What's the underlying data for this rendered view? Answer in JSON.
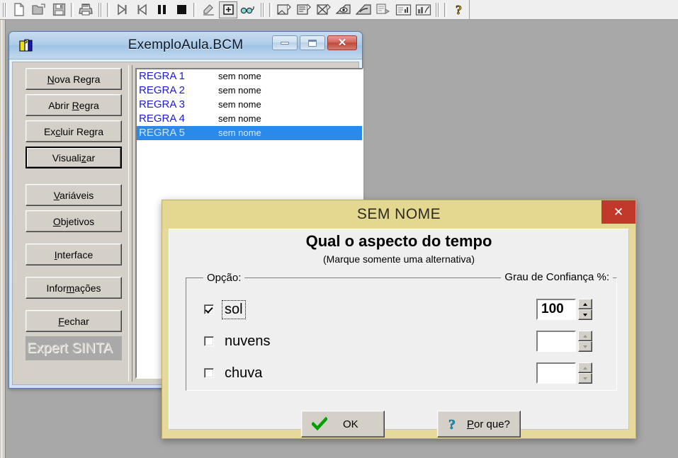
{
  "toolbar": {
    "groups": [
      {
        "name": "file-group",
        "icons": [
          "new-document-icon",
          "open-folder-icon",
          "save-disk-icon"
        ]
      },
      {
        "name": "print-group",
        "icons": [
          "print-icon"
        ]
      },
      {
        "name": "run-group",
        "icons": [
          "step-forward-icon",
          "step-back-icon",
          "pause-icon",
          "stop-icon"
        ]
      },
      {
        "name": "tools-group",
        "icons": [
          "wand-icon",
          "expand-box-icon",
          "glasses-icon"
        ]
      },
      {
        "name": "knowledge-group",
        "icons": [
          "rule-new-icon",
          "rule-edit-icon",
          "rule-delete-icon",
          "eye-view-icon",
          "inference-icon",
          "note-run-icon",
          "report-icon",
          "chart-icon"
        ]
      },
      {
        "name": "help-group",
        "icons": [
          "help-question-icon"
        ]
      }
    ]
  },
  "child_window": {
    "title": "ExemploAula.BCM",
    "icon": "expert-sinta-icon",
    "controls": {
      "minimize": "minimize-button",
      "maximize": "maximize-button",
      "close_glyph": "✕"
    },
    "buttons": [
      {
        "name": "nova-regra",
        "pre": "",
        "accel": "N",
        "post": "ova Regra",
        "default": false
      },
      {
        "name": "abrir-regra",
        "pre": "Abrir ",
        "accel": "R",
        "post": "egra",
        "default": false
      },
      {
        "name": "excluir-regra",
        "pre": "Ex",
        "accel": "c",
        "post": "luir Regra",
        "default": false
      },
      {
        "name": "visualizar",
        "pre": "Visuali",
        "accel": "z",
        "post": "ar",
        "default": true
      },
      {
        "name": "variaveis",
        "pre": "",
        "accel": "V",
        "post": "ariáveis",
        "default": false
      },
      {
        "name": "objetivos",
        "pre": "",
        "accel": "O",
        "post": "bjetivos",
        "default": false
      },
      {
        "name": "interface",
        "pre": "",
        "accel": "I",
        "post": "nterface",
        "default": false
      },
      {
        "name": "informacoes",
        "pre": "Infor",
        "accel": "m",
        "post": "ações",
        "default": false
      },
      {
        "name": "fechar",
        "pre": "",
        "accel": "F",
        "post": "echar",
        "default": false
      }
    ],
    "watermark": "Expert SINTA",
    "rules": [
      {
        "name": "REGRA  1",
        "desc": "sem nome",
        "selected": false
      },
      {
        "name": "REGRA  2",
        "desc": "sem nome",
        "selected": false
      },
      {
        "name": "REGRA  3",
        "desc": "sem nome",
        "selected": false
      },
      {
        "name": "REGRA  4",
        "desc": "sem nome",
        "selected": false
      },
      {
        "name": "REGRA  5",
        "desc": "sem nome",
        "selected": true
      }
    ]
  },
  "dialog": {
    "title": "SEM NOME",
    "close_glyph": "✕",
    "heading": "Qual o aspecto do tempo",
    "subheading": "(Marque somente uma alternativa)",
    "group_label_option": "Opção:",
    "group_label_confidence": "Grau de Confiança %:",
    "options": [
      {
        "label": "sol",
        "checked": true,
        "focused": true,
        "confidence": "100"
      },
      {
        "label": "nuvens",
        "checked": false,
        "focused": false,
        "confidence": ""
      },
      {
        "label": "chuva",
        "checked": false,
        "focused": false,
        "confidence": ""
      }
    ],
    "ok_button": {
      "label": "OK",
      "icon": "green-check-icon"
    },
    "why_button": {
      "pre": "",
      "accel": "P",
      "post": "or que?",
      "icon": "blue-question-icon"
    }
  },
  "colors": {
    "dialog_frame": "#e6d99b",
    "dialog_titlebar": "#e4d790",
    "dialog_close": "#c0392b",
    "selection_blue": "#2a8aec",
    "rule_text_blue": "#1b1bd0",
    "desktop_gray": "#a8a8a8",
    "face_gray": "#d4d0c8",
    "ok_check_green": "#00a000",
    "question_blue": "#0b9ec4"
  }
}
